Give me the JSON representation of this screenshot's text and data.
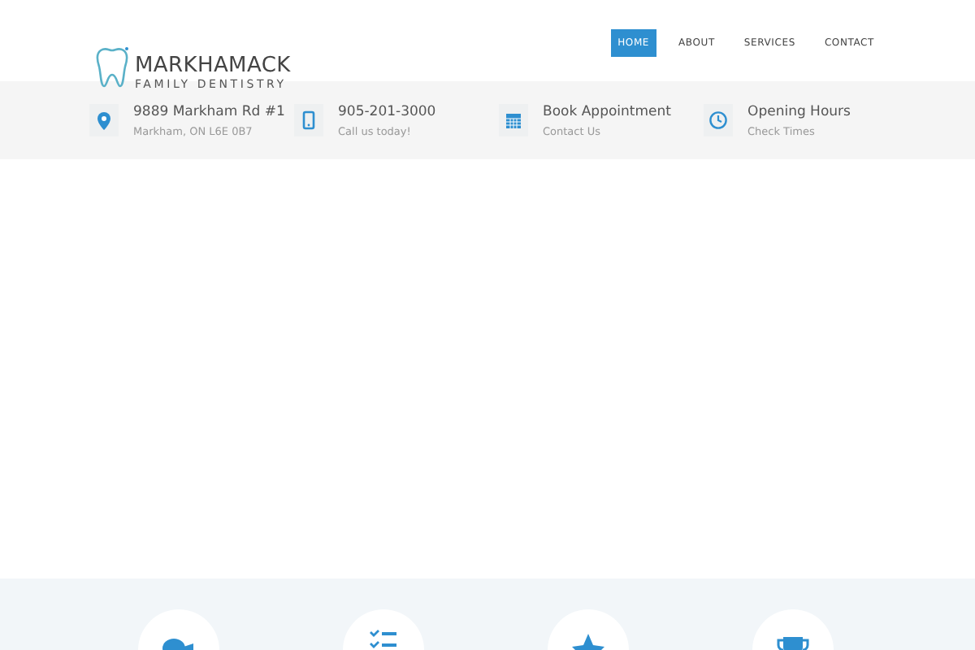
{
  "logo": {
    "name": "MARKHAMACK",
    "tagline": "FAMILY DENTISTRY"
  },
  "nav": [
    {
      "label": "HOME",
      "selected": true
    },
    {
      "label": "ABOUT",
      "selected": false
    },
    {
      "label": "SERVICES",
      "selected": false
    },
    {
      "label": "CONTACT",
      "selected": false
    }
  ],
  "info": [
    {
      "kind": "pin",
      "title": "9889 Markham Rd #1",
      "subtitle": "Markham, ON L6E 0B7"
    },
    {
      "kind": "phone",
      "title": "905-201-3000",
      "subtitle": "Call us today!"
    },
    {
      "kind": "calendar",
      "title": "Book Appointment",
      "subtitle": "Contact Us"
    },
    {
      "kind": "clock",
      "title": "Opening Hours",
      "subtitle": "Check Times"
    }
  ],
  "features": [
    {
      "kind": "chat"
    },
    {
      "kind": "checklist"
    },
    {
      "kind": "star"
    },
    {
      "kind": "trophy"
    }
  ]
}
